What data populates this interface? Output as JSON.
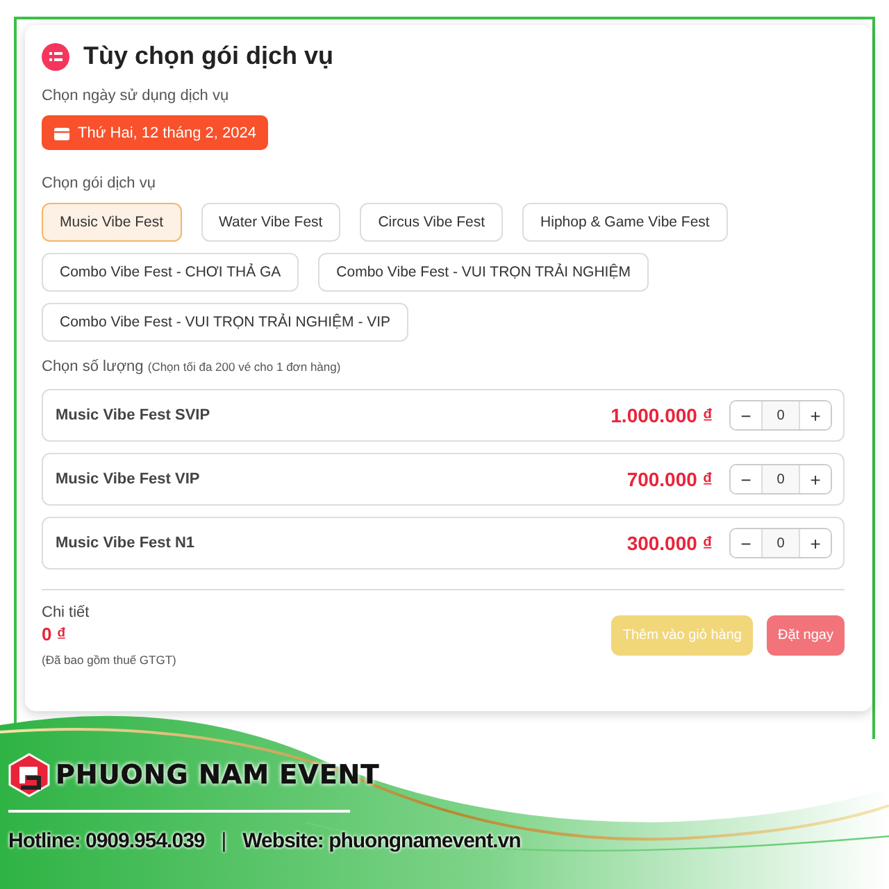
{
  "title": "Tùy chọn gói dịch vụ",
  "date_section": {
    "label": "Chọn ngày sử dụng dịch vụ",
    "date": "Thứ Hai, 12 tháng 2, 2024"
  },
  "package_section": {
    "label": "Chọn gói dịch vụ",
    "packages": [
      {
        "label": "Music Vibe Fest",
        "selected": true
      },
      {
        "label": "Water Vibe Fest",
        "selected": false
      },
      {
        "label": "Circus Vibe Fest",
        "selected": false
      },
      {
        "label": "Hiphop & Game Vibe Fest",
        "selected": false
      },
      {
        "label": "Combo Vibe Fest - CHƠI THẢ GA",
        "selected": false
      },
      {
        "label": "Combo Vibe Fest - VUI TRỌN TRẢI NGHIỆM",
        "selected": false
      },
      {
        "label": "Combo Vibe Fest - VUI TRỌN TRẢI NGHIỆM - VIP",
        "selected": false
      }
    ]
  },
  "quantity_section": {
    "label": "Chọn số lượng",
    "note": "(Chọn tối đa 200 vé cho 1 đơn hàng)",
    "tickets": [
      {
        "name": "Music Vibe Fest SVIP",
        "price": "1.000.000 ₫",
        "minus": "−",
        "quantity": "0",
        "plus": "+"
      },
      {
        "name": "Music Vibe Fest VIP",
        "price": "700.000 ₫",
        "minus": "−",
        "quantity": "0",
        "plus": "+"
      },
      {
        "name": "Music Vibe Fest N1",
        "price": "300.000 ₫",
        "minus": "−",
        "quantity": "0",
        "plus": "+"
      }
    ]
  },
  "summary": {
    "label": "Chi tiết",
    "total": "0 ₫",
    "tax_note": "(Đã bao gồm thuế GTGT)",
    "buttons": [
      {
        "label": "Thêm vào giỏ hàng",
        "kind": "cart"
      },
      {
        "label": "Đặt ngay",
        "kind": "buy"
      }
    ]
  },
  "banner": {
    "brand": "PHUONG NAM EVENT",
    "hotline": "Hotline: 0909.954.039",
    "separator": "|",
    "website": "Website: phuongnamevent.vn"
  }
}
